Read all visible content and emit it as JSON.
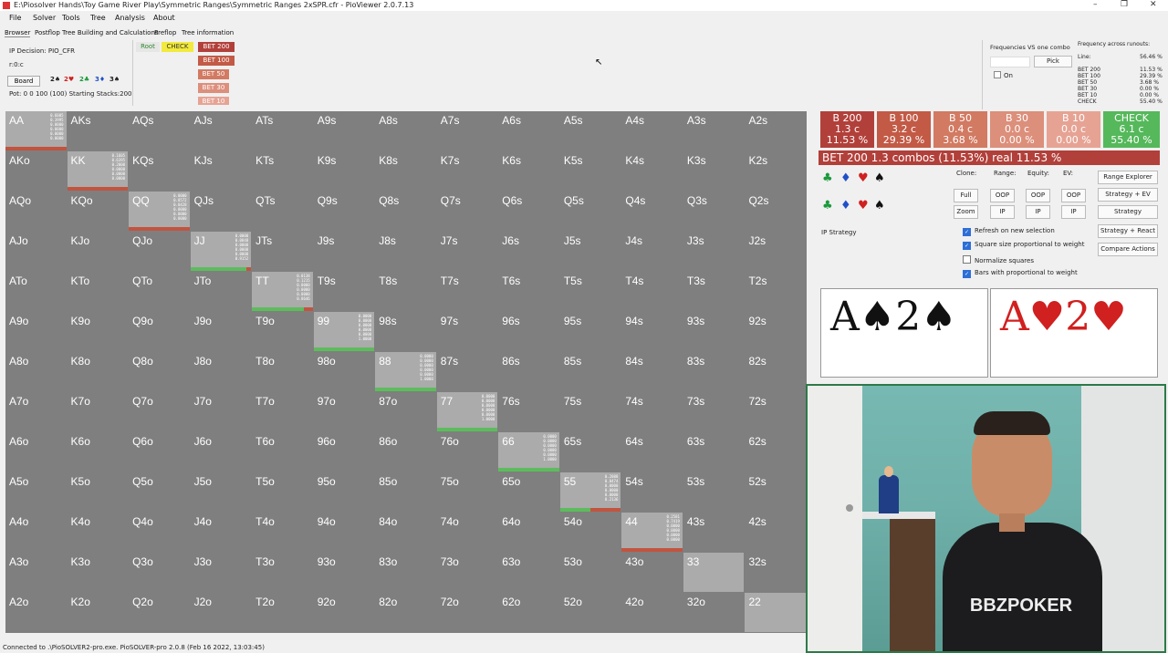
{
  "window": {
    "title": "E:\\Piosolver Hands\\Toy Game River Play\\Symmetric Ranges\\Symmetric Ranges 2xSPR.cfr - PioViewer 2.0.7.13",
    "controls": [
      "–",
      "❐",
      "✕"
    ]
  },
  "menu": [
    "File",
    "Solver",
    "Tools",
    "Tree",
    "Analysis",
    "About"
  ],
  "tabs": [
    "Browser",
    "Postflop Tree Building and Calculations",
    "Preflop",
    "Tree information"
  ],
  "info": {
    "decision": "IP Decision:  PIO_CFR",
    "path": "r:0:c",
    "board_label": "Board",
    "board_cards": [
      "2♠",
      "2♥",
      "2♣",
      "3♦",
      "3♠"
    ],
    "pot": "Pot: 0 0 100 (100) Starting Stacks:200"
  },
  "tree": {
    "root": "Root",
    "check": "CHECK",
    "bets": [
      "BET 200",
      "BET 100",
      "BET 50",
      "BET 30",
      "BET 10"
    ]
  },
  "freq": {
    "title": "Frequencies VS one combo",
    "pick": "Pick",
    "on": "On",
    "across_title": "Frequency across runouts:",
    "line_label": "Line:",
    "line_val": "56.46 %",
    "rows": [
      {
        "label": "BET 200",
        "val": "11.53 %"
      },
      {
        "label": "BET 100",
        "val": "29.39 %"
      },
      {
        "label": "BET 50",
        "val": "3.68 %"
      },
      {
        "label": "BET 30",
        "val": "0.00 %"
      },
      {
        "label": "BET 10",
        "val": "0.00 %"
      },
      {
        "label": "CHECK",
        "val": "55.40 %"
      }
    ]
  },
  "grid": {
    "rows": [
      [
        "AA",
        "AKs",
        "AQs",
        "AJs",
        "ATs",
        "A9s",
        "A8s",
        "A7s",
        "A6s",
        "A5s",
        "A4s",
        "A3s",
        "A2s"
      ],
      [
        "AKo",
        "KK",
        "KQs",
        "KJs",
        "KTs",
        "K9s",
        "K8s",
        "K7s",
        "K6s",
        "K5s",
        "K4s",
        "K3s",
        "K2s"
      ],
      [
        "AQo",
        "KQo",
        "QQ",
        "QJs",
        "QTs",
        "Q9s",
        "Q8s",
        "Q7s",
        "Q6s",
        "Q5s",
        "Q4s",
        "Q3s",
        "Q2s"
      ],
      [
        "AJo",
        "KJo",
        "QJo",
        "JJ",
        "JTs",
        "J9s",
        "J8s",
        "J7s",
        "J6s",
        "J5s",
        "J4s",
        "J3s",
        "J2s"
      ],
      [
        "ATo",
        "KTo",
        "QTo",
        "JTo",
        "TT",
        "T9s",
        "T8s",
        "T7s",
        "T6s",
        "T5s",
        "T4s",
        "T3s",
        "T2s"
      ],
      [
        "A9o",
        "K9o",
        "Q9o",
        "J9o",
        "T9o",
        "99",
        "98s",
        "97s",
        "96s",
        "95s",
        "94s",
        "93s",
        "92s"
      ],
      [
        "A8o",
        "K8o",
        "Q8o",
        "J8o",
        "T8o",
        "98o",
        "88",
        "87s",
        "86s",
        "85s",
        "84s",
        "83s",
        "82s"
      ],
      [
        "A7o",
        "K7o",
        "Q7o",
        "J7o",
        "T7o",
        "97o",
        "87o",
        "77",
        "76s",
        "75s",
        "74s",
        "73s",
        "72s"
      ],
      [
        "A6o",
        "K6o",
        "Q6o",
        "J6o",
        "T6o",
        "96o",
        "86o",
        "76o",
        "66",
        "65s",
        "64s",
        "63s",
        "62s"
      ],
      [
        "A5o",
        "K5o",
        "Q5o",
        "J5o",
        "T5o",
        "95o",
        "85o",
        "75o",
        "65o",
        "55",
        "54s",
        "53s",
        "52s"
      ],
      [
        "A4o",
        "K4o",
        "Q4o",
        "J4o",
        "T4o",
        "94o",
        "84o",
        "74o",
        "64o",
        "54o",
        "44",
        "43s",
        "42s"
      ],
      [
        "A3o",
        "K3o",
        "Q3o",
        "J3o",
        "T3o",
        "93o",
        "83o",
        "73o",
        "63o",
        "53o",
        "43o",
        "33",
        "32s"
      ],
      [
        "A2o",
        "K2o",
        "Q2o",
        "J2o",
        "T2o",
        "92o",
        "82o",
        "72o",
        "62o",
        "52o",
        "42o",
        "32o",
        "22"
      ]
    ],
    "pairs": [
      {
        "idx": 0,
        "mini": [
          "0.6005",
          "0.3995",
          "0.0000",
          "0.0000",
          "0.0000",
          "0.0000"
        ],
        "green": 0.0,
        "red": 1.0
      },
      {
        "idx": 1,
        "mini": [
          "0.1605",
          "0.6395",
          "0.2000",
          "0.0000",
          "0.0000",
          "0.0000"
        ],
        "green": 0.0,
        "red": 1.0
      },
      {
        "idx": 2,
        "mini": [
          "0.0000",
          "0.8572",
          "0.0428",
          "0.0000",
          "0.0000",
          "0.0000"
        ],
        "green": 0.0,
        "red": 1.0
      },
      {
        "idx": 3,
        "mini": [
          "0.0000",
          "0.0848",
          "0.0000",
          "0.0000",
          "0.0000",
          "0.9152"
        ],
        "green": 0.92,
        "red": 0.08
      },
      {
        "idx": 4,
        "mini": [
          "0.0138",
          "0.1215",
          "0.0000",
          "0.0000",
          "0.0000",
          "0.8646"
        ],
        "green": 0.86,
        "red": 0.14
      },
      {
        "idx": 5,
        "mini": [
          "0.0000",
          "0.0000",
          "0.0000",
          "0.0000",
          "0.0000",
          "1.0000"
        ],
        "green": 1.0,
        "red": 0.0
      },
      {
        "idx": 6,
        "mini": [
          "0.0000",
          "0.0000",
          "0.0000",
          "0.0000",
          "0.0000",
          "1.0000"
        ],
        "green": 1.0,
        "red": 0.0
      },
      {
        "idx": 7,
        "mini": [
          "0.0000",
          "0.0000",
          "0.0000",
          "0.0000",
          "0.0000",
          "1.0000"
        ],
        "green": 1.0,
        "red": 0.0
      },
      {
        "idx": 8,
        "mini": [
          "0.0000",
          "0.0000",
          "0.0000",
          "0.0000",
          "0.0000",
          "1.0000"
        ],
        "green": 1.0,
        "red": 0.0
      },
      {
        "idx": 9,
        "mini": [
          "0.2088",
          "0.0474",
          "0.0000",
          "0.0000",
          "0.0000",
          "0.2136"
        ],
        "green": 0.5,
        "red": 0.5
      },
      {
        "idx": 10,
        "mini": [
          "0.2581",
          "0.7419",
          "0.0000",
          "0.0000",
          "0.0000",
          "0.0000"
        ],
        "green": 0.0,
        "red": 1.0
      },
      {
        "idx": 11,
        "mini": [],
        "green": 0.0,
        "red": 0.0
      },
      {
        "idx": 12,
        "mini": [],
        "green": 0.0,
        "red": 0.0
      }
    ]
  },
  "actions": [
    {
      "name": "B 200",
      "combos": "1.3 c",
      "pct": "11.53 %",
      "color": "#b2403a"
    },
    {
      "name": "B 100",
      "combos": "3.2 c",
      "pct": "29.39 %",
      "color": "#c25a46"
    },
    {
      "name": "B 50",
      "combos": "0.4 c",
      "pct": "3.68 %",
      "color": "#d27a62"
    },
    {
      "name": "B 30",
      "combos": "0.0 c",
      "pct": "0.00 %",
      "color": "#dc8f7b"
    },
    {
      "name": "B 10",
      "combos": "0.0 c",
      "pct": "0.00 %",
      "color": "#e6a394"
    },
    {
      "name": "CHECK",
      "combos": "6.1 c",
      "pct": "55.40 %",
      "color": "#55b85b"
    }
  ],
  "combobar": {
    "text": "BET 200   1.3 combos (11.53%) real  11.53 %",
    "green_frac": 0.0
  },
  "controls": {
    "clone": "Clone:",
    "range": "Range:",
    "equity": "Equity:",
    "ev": "EV:",
    "full": "Full",
    "zoom": "Zoom",
    "oop": "OOP",
    "ip": "IP",
    "range_explorer": "Range Explorer",
    "strategy_ev": "Strategy + EV",
    "strategy": "Strategy",
    "strategy_react": "Strategy + React",
    "compare": "Compare Actions",
    "ip_strategy": "IP Strategy",
    "checks": [
      {
        "label": "Refresh on new selection",
        "on": true
      },
      {
        "label": "Square size proportional to weight",
        "on": true
      },
      {
        "label": "Normalize squares",
        "on": false
      },
      {
        "label": "Bars with proportional to weight",
        "on": true
      }
    ]
  },
  "cards": [
    {
      "text": "A♠2♠",
      "color": "#111111"
    },
    {
      "text": "A♥2♥",
      "color": "#d0201f"
    }
  ],
  "webcam": {
    "logo": "BBZPOKER"
  },
  "status": "Connected to .\\PioSOLVER2-pro.exe. PioSOLVER-pro 2.0.8 (Feb 16 2022, 13:03:45)"
}
